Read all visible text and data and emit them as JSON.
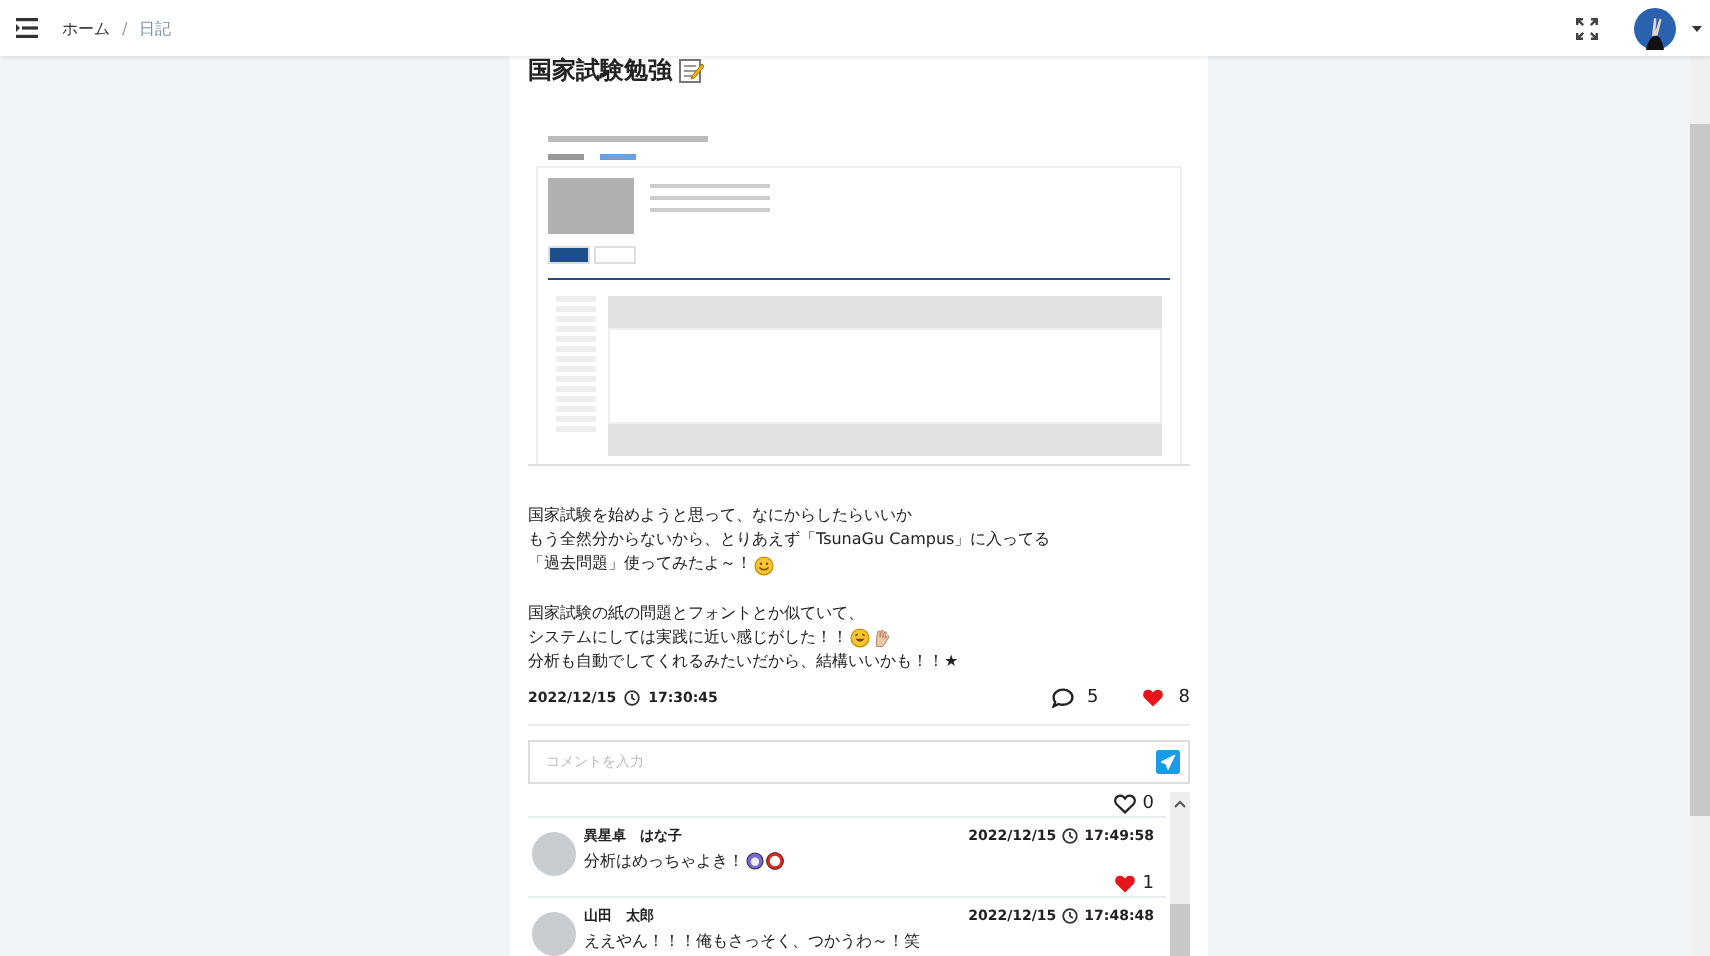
{
  "breadcrumb": {
    "separator": "/",
    "items": [
      {
        "label": "ホーム",
        "current": false
      },
      {
        "label": "日記",
        "current": true
      }
    ]
  },
  "post": {
    "title": "国家試験勉強",
    "title_emojis": [
      {
        "kind": "memo"
      }
    ],
    "body": [
      {
        "lines": [
          {
            "text": "国家試験を始めようと思って、なにからしたらいいか"
          },
          {
            "text": "もう全然分からないから、とりあえず「TsunaGu Campus」に入ってる"
          },
          {
            "text": "「過去問題」使ってみたよ～！",
            "emojis": [
              {
                "kind": "smile"
              }
            ]
          }
        ]
      },
      {
        "lines": [
          {
            "text": "国家試験の紙の問題とフォントとか似ていて、"
          },
          {
            "text": "システムにしては実践に近い感じがした！！",
            "emojis": [
              {
                "kind": "grin"
              },
              {
                "kind": "hand"
              }
            ]
          },
          {
            "text": "分析も自動でしてくれるみたいだから、結構いいかも！！★"
          }
        ]
      }
    ],
    "date": "2022/12/15",
    "time": "17:30:45",
    "comment_count": "5",
    "likes": "8",
    "liked": true
  },
  "comment_input": {
    "placeholder": "コメントを入力"
  },
  "comment_likes": {
    "count": "0",
    "liked": false
  },
  "comments": [
    {
      "name": "異星卓　はな子",
      "date": "2022/12/15",
      "time": "17:49:58",
      "text": "分析はめっちゃよき！",
      "emojis": [
        {
          "kind": "badge"
        },
        {
          "kind": "ring"
        }
      ],
      "likes": "1",
      "liked": true
    },
    {
      "name": "山田　太郎",
      "date": "2022/12/15",
      "time": "17:48:48",
      "text": "ええやん！！！俺もさっそく、つかうわ～！笑"
    }
  ]
}
